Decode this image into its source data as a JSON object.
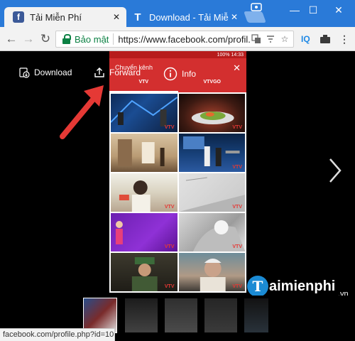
{
  "browser": {
    "tabs": [
      {
        "label": "Tải Miễn Phí",
        "favicon": "facebook-icon",
        "active": true
      },
      {
        "label": "Download - Tải Miễn Phí",
        "favicon": "taimienphi-icon",
        "active": false
      }
    ],
    "omnibox": {
      "secure_label": "Bảo mật",
      "url": "https://www.facebook.com/profil..."
    },
    "extensions": [
      "IQ"
    ],
    "status_url": "facebook.com/profile.php?id=10..."
  },
  "viewer": {
    "download_label": "Download",
    "forward_label": "Forward",
    "info_label": "Info"
  },
  "phone": {
    "status_text": "100% 14:33",
    "title": "Chuyển kênh",
    "tabs": [
      "VTV",
      "VTVGO"
    ],
    "thumb_logos": [
      "VTV",
      "VTV",
      "",
      "VTV",
      "VTV",
      "VTV",
      "VTV",
      "VTV",
      "VTV",
      "VTV"
    ]
  },
  "watermark": {
    "initial": "T",
    "name": "aimienphi",
    "tld": ".vn"
  },
  "colors": {
    "tab_strip": "#2a7ad8",
    "phone_header": "#d32f2f",
    "arrow": "#e53935",
    "secure": "#0b8043"
  }
}
